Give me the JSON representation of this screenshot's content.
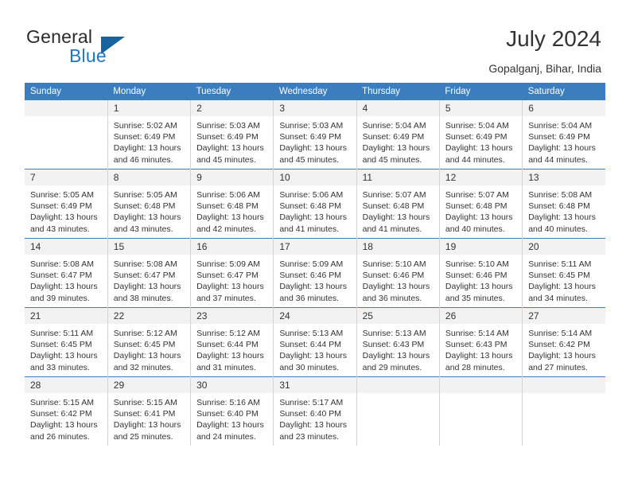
{
  "brand": {
    "name_part1": "General",
    "name_part2": "Blue",
    "triangle_color": "#17639e",
    "blue_color": "#2077c6"
  },
  "header": {
    "title": "July 2024",
    "location": "Gopalganj, Bihar, India"
  },
  "theme": {
    "header_row_bg": "#3b7ec0",
    "header_row_text": "#ffffff",
    "daynum_bg": "#f2f2f2",
    "row_separator": "#3b7ec0",
    "column_separator": "#d4d4d4",
    "body_text": "#333333"
  },
  "weekday_headers": [
    "Sunday",
    "Monday",
    "Tuesday",
    "Wednesday",
    "Thursday",
    "Friday",
    "Saturday"
  ],
  "weeks": [
    {
      "days": [
        {
          "day": "",
          "sunrise": "",
          "sunset": "",
          "daylight1": "",
          "daylight2": "",
          "blank": true
        },
        {
          "day": "1",
          "sunrise": "Sunrise: 5:02 AM",
          "sunset": "Sunset: 6:49 PM",
          "daylight1": "Daylight: 13 hours",
          "daylight2": "and 46 minutes.",
          "blank": false
        },
        {
          "day": "2",
          "sunrise": "Sunrise: 5:03 AM",
          "sunset": "Sunset: 6:49 PM",
          "daylight1": "Daylight: 13 hours",
          "daylight2": "and 45 minutes.",
          "blank": false
        },
        {
          "day": "3",
          "sunrise": "Sunrise: 5:03 AM",
          "sunset": "Sunset: 6:49 PM",
          "daylight1": "Daylight: 13 hours",
          "daylight2": "and 45 minutes.",
          "blank": false
        },
        {
          "day": "4",
          "sunrise": "Sunrise: 5:04 AM",
          "sunset": "Sunset: 6:49 PM",
          "daylight1": "Daylight: 13 hours",
          "daylight2": "and 45 minutes.",
          "blank": false
        },
        {
          "day": "5",
          "sunrise": "Sunrise: 5:04 AM",
          "sunset": "Sunset: 6:49 PM",
          "daylight1": "Daylight: 13 hours",
          "daylight2": "and 44 minutes.",
          "blank": false
        },
        {
          "day": "6",
          "sunrise": "Sunrise: 5:04 AM",
          "sunset": "Sunset: 6:49 PM",
          "daylight1": "Daylight: 13 hours",
          "daylight2": "and 44 minutes.",
          "blank": false
        }
      ]
    },
    {
      "days": [
        {
          "day": "7",
          "sunrise": "Sunrise: 5:05 AM",
          "sunset": "Sunset: 6:49 PM",
          "daylight1": "Daylight: 13 hours",
          "daylight2": "and 43 minutes.",
          "blank": false
        },
        {
          "day": "8",
          "sunrise": "Sunrise: 5:05 AM",
          "sunset": "Sunset: 6:48 PM",
          "daylight1": "Daylight: 13 hours",
          "daylight2": "and 43 minutes.",
          "blank": false
        },
        {
          "day": "9",
          "sunrise": "Sunrise: 5:06 AM",
          "sunset": "Sunset: 6:48 PM",
          "daylight1": "Daylight: 13 hours",
          "daylight2": "and 42 minutes.",
          "blank": false
        },
        {
          "day": "10",
          "sunrise": "Sunrise: 5:06 AM",
          "sunset": "Sunset: 6:48 PM",
          "daylight1": "Daylight: 13 hours",
          "daylight2": "and 41 minutes.",
          "blank": false
        },
        {
          "day": "11",
          "sunrise": "Sunrise: 5:07 AM",
          "sunset": "Sunset: 6:48 PM",
          "daylight1": "Daylight: 13 hours",
          "daylight2": "and 41 minutes.",
          "blank": false
        },
        {
          "day": "12",
          "sunrise": "Sunrise: 5:07 AM",
          "sunset": "Sunset: 6:48 PM",
          "daylight1": "Daylight: 13 hours",
          "daylight2": "and 40 minutes.",
          "blank": false
        },
        {
          "day": "13",
          "sunrise": "Sunrise: 5:08 AM",
          "sunset": "Sunset: 6:48 PM",
          "daylight1": "Daylight: 13 hours",
          "daylight2": "and 40 minutes.",
          "blank": false
        }
      ]
    },
    {
      "days": [
        {
          "day": "14",
          "sunrise": "Sunrise: 5:08 AM",
          "sunset": "Sunset: 6:47 PM",
          "daylight1": "Daylight: 13 hours",
          "daylight2": "and 39 minutes.",
          "blank": false
        },
        {
          "day": "15",
          "sunrise": "Sunrise: 5:08 AM",
          "sunset": "Sunset: 6:47 PM",
          "daylight1": "Daylight: 13 hours",
          "daylight2": "and 38 minutes.",
          "blank": false
        },
        {
          "day": "16",
          "sunrise": "Sunrise: 5:09 AM",
          "sunset": "Sunset: 6:47 PM",
          "daylight1": "Daylight: 13 hours",
          "daylight2": "and 37 minutes.",
          "blank": false
        },
        {
          "day": "17",
          "sunrise": "Sunrise: 5:09 AM",
          "sunset": "Sunset: 6:46 PM",
          "daylight1": "Daylight: 13 hours",
          "daylight2": "and 36 minutes.",
          "blank": false
        },
        {
          "day": "18",
          "sunrise": "Sunrise: 5:10 AM",
          "sunset": "Sunset: 6:46 PM",
          "daylight1": "Daylight: 13 hours",
          "daylight2": "and 36 minutes.",
          "blank": false
        },
        {
          "day": "19",
          "sunrise": "Sunrise: 5:10 AM",
          "sunset": "Sunset: 6:46 PM",
          "daylight1": "Daylight: 13 hours",
          "daylight2": "and 35 minutes.",
          "blank": false
        },
        {
          "day": "20",
          "sunrise": "Sunrise: 5:11 AM",
          "sunset": "Sunset: 6:45 PM",
          "daylight1": "Daylight: 13 hours",
          "daylight2": "and 34 minutes.",
          "blank": false
        }
      ]
    },
    {
      "days": [
        {
          "day": "21",
          "sunrise": "Sunrise: 5:11 AM",
          "sunset": "Sunset: 6:45 PM",
          "daylight1": "Daylight: 13 hours",
          "daylight2": "and 33 minutes.",
          "blank": false
        },
        {
          "day": "22",
          "sunrise": "Sunrise: 5:12 AM",
          "sunset": "Sunset: 6:45 PM",
          "daylight1": "Daylight: 13 hours",
          "daylight2": "and 32 minutes.",
          "blank": false
        },
        {
          "day": "23",
          "sunrise": "Sunrise: 5:12 AM",
          "sunset": "Sunset: 6:44 PM",
          "daylight1": "Daylight: 13 hours",
          "daylight2": "and 31 minutes.",
          "blank": false
        },
        {
          "day": "24",
          "sunrise": "Sunrise: 5:13 AM",
          "sunset": "Sunset: 6:44 PM",
          "daylight1": "Daylight: 13 hours",
          "daylight2": "and 30 minutes.",
          "blank": false
        },
        {
          "day": "25",
          "sunrise": "Sunrise: 5:13 AM",
          "sunset": "Sunset: 6:43 PM",
          "daylight1": "Daylight: 13 hours",
          "daylight2": "and 29 minutes.",
          "blank": false
        },
        {
          "day": "26",
          "sunrise": "Sunrise: 5:14 AM",
          "sunset": "Sunset: 6:43 PM",
          "daylight1": "Daylight: 13 hours",
          "daylight2": "and 28 minutes.",
          "blank": false
        },
        {
          "day": "27",
          "sunrise": "Sunrise: 5:14 AM",
          "sunset": "Sunset: 6:42 PM",
          "daylight1": "Daylight: 13 hours",
          "daylight2": "and 27 minutes.",
          "blank": false
        }
      ]
    },
    {
      "days": [
        {
          "day": "28",
          "sunrise": "Sunrise: 5:15 AM",
          "sunset": "Sunset: 6:42 PM",
          "daylight1": "Daylight: 13 hours",
          "daylight2": "and 26 minutes.",
          "blank": false
        },
        {
          "day": "29",
          "sunrise": "Sunrise: 5:15 AM",
          "sunset": "Sunset: 6:41 PM",
          "daylight1": "Daylight: 13 hours",
          "daylight2": "and 25 minutes.",
          "blank": false
        },
        {
          "day": "30",
          "sunrise": "Sunrise: 5:16 AM",
          "sunset": "Sunset: 6:40 PM",
          "daylight1": "Daylight: 13 hours",
          "daylight2": "and 24 minutes.",
          "blank": false
        },
        {
          "day": "31",
          "sunrise": "Sunrise: 5:17 AM",
          "sunset": "Sunset: 6:40 PM",
          "daylight1": "Daylight: 13 hours",
          "daylight2": "and 23 minutes.",
          "blank": false
        },
        {
          "day": "",
          "sunrise": "",
          "sunset": "",
          "daylight1": "",
          "daylight2": "",
          "blank": true
        },
        {
          "day": "",
          "sunrise": "",
          "sunset": "",
          "daylight1": "",
          "daylight2": "",
          "blank": true
        },
        {
          "day": "",
          "sunrise": "",
          "sunset": "",
          "daylight1": "",
          "daylight2": "",
          "blank": true
        }
      ]
    }
  ]
}
